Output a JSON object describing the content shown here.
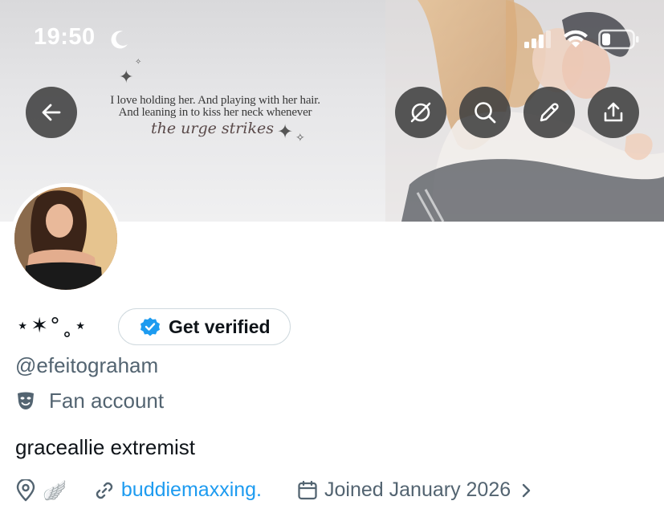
{
  "status_bar": {
    "time": "19:50"
  },
  "banner": {
    "quote_line_1": "I love holding her. And playing with her hair.",
    "quote_line_2": "And leaning in to kiss her neck whenever",
    "quote_line_3": "the urge strikes"
  },
  "profile": {
    "display_name": "⋆✶°˳⋆",
    "verify_label": "Get verified",
    "handle": "@efeitograham",
    "category": "Fan account",
    "bio": "graceallie extremist",
    "location_emoji": "🪽",
    "link": "buddiemaxxing.",
    "joined": "Joined January 2026"
  },
  "colors": {
    "accent": "#1d9bf0",
    "secondary_text": "#536471",
    "button_bg": "#404040"
  },
  "icons": {
    "back": "arrow-left-icon",
    "grok": "grok-icon",
    "search": "search-icon",
    "edit": "pencil-icon",
    "share": "share-icon"
  }
}
